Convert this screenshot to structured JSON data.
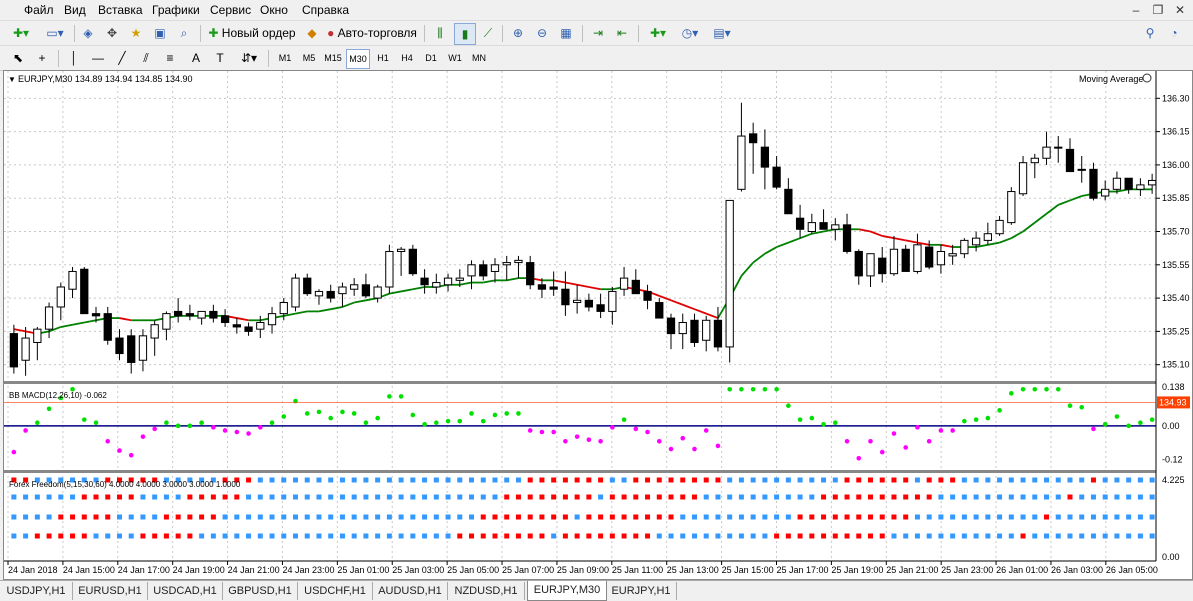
{
  "menu": [
    "Файл",
    "Вид",
    "Вставка",
    "Графики",
    "Сервис",
    "Окно",
    "Справка"
  ],
  "toolbar": {
    "new_order": "Новый ордер",
    "autotrading": "Авто-торговля"
  },
  "timeframes": [
    "M1",
    "M5",
    "M15",
    "M30",
    "H1",
    "H4",
    "D1",
    "W1",
    "MN"
  ],
  "active_timeframe": "M30",
  "chart": {
    "header": "EURJPY,M30  134.89 134.94 134.85 134.90",
    "indicator_label": "Moving Average",
    "current_price": "134.93",
    "price_ticks": [
      "136.30",
      "136.15",
      "136.00",
      "135.85",
      "135.70",
      "135.55",
      "135.40",
      "135.25",
      "135.10"
    ],
    "macd_label": "BB MACD(12,26,10) -0.062",
    "macd_ticks": [
      "0.138",
      "0.00",
      "-0.12"
    ],
    "ff_label": "Forex Freedom(5,15,30,60) 4.0000 4.0000 3.0000 3.0000 1.0000",
    "ff_ticks": [
      "4.225",
      "0.00"
    ],
    "time_labels": [
      "24 Jan 2018",
      "24 Jan 15:00",
      "24 Jan 17:00",
      "24 Jan 19:00",
      "24 Jan 21:00",
      "24 Jan 23:00",
      "25 Jan 01:00",
      "25 Jan 03:00",
      "25 Jan 05:00",
      "25 Jan 07:00",
      "25 Jan 09:00",
      "25 Jan 11:00",
      "25 Jan 13:00",
      "25 Jan 15:00",
      "25 Jan 17:00",
      "25 Jan 19:00",
      "25 Jan 21:00",
      "25 Jan 23:00",
      "26 Jan 01:00",
      "26 Jan 03:00",
      "26 Jan 05:00"
    ],
    "colors": {
      "bull": "#ffffff",
      "bear": "#000000",
      "ma_up": "#008000",
      "ma_down": "#e00000",
      "macd_up": "#00e000",
      "macd_down": "#ff00ff",
      "zero_line": "#000080",
      "ff_blue": "#3399ff",
      "ff_red": "#ff0000",
      "price_label": "#ff4000"
    }
  },
  "tabs": [
    "USDJPY,H1",
    "EURUSD,H1",
    "USDCAD,H1",
    "GBPUSD,H1",
    "USDCHF,H1",
    "AUDUSD,H1",
    "NZDUSD,H1",
    "EURJPY,M30",
    "EURJPY,H1"
  ],
  "active_tab": "EURJPY,M30",
  "chart_data": {
    "type": "candlestick",
    "symbol": "EURJPY",
    "timeframe": "M30",
    "ylim": [
      135.04,
      136.36
    ],
    "candles": [
      [
        135.24,
        135.28,
        135.06,
        135.09
      ],
      [
        135.12,
        135.27,
        135.05,
        135.22
      ],
      [
        135.2,
        135.27,
        135.12,
        135.26
      ],
      [
        135.26,
        135.38,
        135.22,
        135.36
      ],
      [
        135.36,
        135.47,
        135.3,
        135.45
      ],
      [
        135.44,
        135.54,
        135.4,
        135.52
      ],
      [
        135.53,
        135.54,
        135.35,
        135.33
      ],
      [
        135.33,
        135.36,
        135.29,
        135.32
      ],
      [
        135.33,
        135.36,
        135.19,
        135.21
      ],
      [
        135.22,
        135.26,
        135.12,
        135.15
      ],
      [
        135.23,
        135.26,
        135.06,
        135.11
      ],
      [
        135.12,
        135.26,
        135.07,
        135.23
      ],
      [
        135.22,
        135.3,
        135.14,
        135.28
      ],
      [
        135.26,
        135.34,
        135.21,
        135.33
      ],
      [
        135.34,
        135.4,
        135.29,
        135.32
      ],
      [
        135.33,
        135.37,
        135.3,
        135.32
      ],
      [
        135.31,
        135.34,
        135.28,
        135.34
      ],
      [
        135.34,
        135.37,
        135.29,
        135.31
      ],
      [
        135.32,
        135.35,
        135.27,
        135.29
      ],
      [
        135.28,
        135.31,
        135.24,
        135.27
      ],
      [
        135.27,
        135.29,
        135.23,
        135.25
      ],
      [
        135.26,
        135.32,
        135.22,
        135.29
      ],
      [
        135.28,
        135.36,
        135.24,
        135.33
      ],
      [
        135.33,
        135.4,
        135.3,
        135.38
      ],
      [
        135.36,
        135.51,
        135.34,
        135.49
      ],
      [
        135.49,
        135.51,
        135.41,
        135.42
      ],
      [
        135.41,
        135.44,
        135.37,
        135.43
      ],
      [
        135.43,
        135.46,
        135.38,
        135.4
      ],
      [
        135.42,
        135.47,
        135.36,
        135.45
      ],
      [
        135.44,
        135.49,
        135.41,
        135.46
      ],
      [
        135.46,
        135.51,
        135.4,
        135.41
      ],
      [
        135.4,
        135.46,
        135.38,
        135.45
      ],
      [
        135.45,
        135.64,
        135.42,
        135.61
      ],
      [
        135.61,
        135.63,
        135.5,
        135.62
      ],
      [
        135.62,
        135.64,
        135.5,
        135.51
      ],
      [
        135.49,
        135.53,
        135.42,
        135.46
      ],
      [
        135.45,
        135.51,
        135.42,
        135.47
      ],
      [
        135.46,
        135.51,
        135.43,
        135.49
      ],
      [
        135.48,
        135.53,
        135.45,
        135.49
      ],
      [
        135.5,
        135.57,
        135.44,
        135.55
      ],
      [
        135.55,
        135.57,
        135.48,
        135.5
      ],
      [
        135.52,
        135.58,
        135.47,
        135.55
      ],
      [
        135.55,
        135.59,
        135.48,
        135.56
      ],
      [
        135.56,
        135.59,
        135.49,
        135.57
      ],
      [
        135.56,
        135.59,
        135.44,
        135.46
      ],
      [
        135.46,
        135.49,
        135.4,
        135.44
      ],
      [
        135.45,
        135.52,
        135.41,
        135.44
      ],
      [
        135.44,
        135.52,
        135.32,
        135.37
      ],
      [
        135.38,
        135.46,
        135.33,
        135.39
      ],
      [
        135.39,
        135.42,
        135.34,
        135.36
      ],
      [
        135.37,
        135.42,
        135.31,
        135.34
      ],
      [
        135.34,
        135.45,
        135.28,
        135.43
      ],
      [
        135.44,
        135.54,
        135.41,
        135.49
      ],
      [
        135.48,
        135.53,
        135.42,
        135.42
      ],
      [
        135.43,
        135.46,
        135.35,
        135.39
      ],
      [
        135.38,
        135.4,
        135.31,
        135.31
      ],
      [
        135.31,
        135.33,
        135.17,
        135.24
      ],
      [
        135.24,
        135.33,
        135.17,
        135.29
      ],
      [
        135.3,
        135.33,
        135.18,
        135.2
      ],
      [
        135.21,
        135.32,
        135.16,
        135.3
      ],
      [
        135.3,
        135.36,
        135.16,
        135.18
      ],
      [
        135.18,
        135.82,
        135.11,
        135.84
      ],
      [
        135.89,
        136.28,
        135.88,
        136.13
      ],
      [
        136.14,
        136.19,
        135.96,
        136.1
      ],
      [
        136.08,
        136.16,
        135.89,
        135.99
      ],
      [
        135.99,
        136.04,
        135.89,
        135.9
      ],
      [
        135.89,
        135.94,
        135.78,
        135.78
      ],
      [
        135.76,
        135.82,
        135.67,
        135.71
      ],
      [
        135.7,
        135.78,
        135.69,
        135.74
      ],
      [
        135.74,
        135.8,
        135.71,
        135.71
      ],
      [
        135.71,
        135.76,
        135.66,
        135.73
      ],
      [
        135.73,
        135.78,
        135.6,
        135.61
      ],
      [
        135.61,
        135.62,
        135.46,
        135.5
      ],
      [
        135.5,
        135.6,
        135.45,
        135.6
      ],
      [
        135.58,
        135.63,
        135.47,
        135.51
      ],
      [
        135.51,
        135.68,
        135.5,
        135.62
      ],
      [
        135.62,
        135.64,
        135.52,
        135.52
      ],
      [
        135.52,
        135.69,
        135.51,
        135.64
      ],
      [
        135.63,
        135.66,
        135.53,
        135.54
      ],
      [
        135.55,
        135.64,
        135.51,
        135.61
      ],
      [
        135.59,
        135.64,
        135.55,
        135.6
      ],
      [
        135.6,
        135.67,
        135.58,
        135.66
      ],
      [
        135.64,
        135.7,
        135.61,
        135.67
      ],
      [
        135.66,
        135.74,
        135.64,
        135.69
      ],
      [
        135.69,
        135.77,
        135.68,
        135.75
      ],
      [
        135.74,
        135.9,
        135.73,
        135.88
      ],
      [
        135.87,
        136.04,
        135.86,
        136.01
      ],
      [
        136.01,
        136.05,
        135.94,
        136.03
      ],
      [
        136.03,
        136.15,
        136.0,
        136.08
      ],
      [
        136.08,
        136.13,
        136.01,
        136.08
      ],
      [
        136.07,
        136.12,
        135.97,
        135.97
      ],
      [
        135.98,
        136.04,
        135.92,
        135.98
      ],
      [
        135.98,
        136.01,
        135.84,
        135.85
      ],
      [
        135.86,
        135.93,
        135.84,
        135.89
      ],
      [
        135.89,
        135.97,
        135.87,
        135.94
      ],
      [
        135.94,
        135.94,
        135.87,
        135.89
      ],
      [
        135.89,
        135.94,
        135.86,
        135.91
      ],
      [
        135.91,
        135.96,
        135.87,
        135.93
      ]
    ],
    "ma": [
      135.26,
      135.25,
      135.24,
      135.25,
      135.27,
      135.28,
      135.29,
      135.3,
      135.31,
      135.31,
      135.3,
      135.3,
      135.3,
      135.31,
      135.32,
      135.32,
      135.32,
      135.32,
      135.32,
      135.31,
      135.3,
      135.3,
      135.31,
      135.32,
      135.33,
      135.34,
      135.34,
      135.35,
      135.36,
      135.38,
      135.39,
      135.4,
      135.42,
      135.43,
      135.44,
      135.45,
      135.45,
      135.46,
      135.46,
      135.47,
      135.47,
      135.48,
      135.48,
      135.49,
      135.49,
      135.48,
      135.48,
      135.47,
      135.46,
      135.45,
      135.44,
      135.44,
      135.45,
      135.44,
      135.43,
      135.41,
      135.39,
      135.37,
      135.35,
      135.33,
      135.31,
      135.4,
      135.5,
      135.56,
      135.6,
      135.63,
      135.65,
      135.67,
      135.69,
      135.7,
      135.71,
      135.71,
      135.71,
      135.7,
      135.68,
      135.67,
      135.66,
      135.65,
      135.64,
      135.64,
      135.63,
      135.63,
      135.63,
      135.64,
      135.65,
      135.67,
      135.7,
      135.74,
      135.78,
      135.82,
      135.84,
      135.86,
      135.87,
      135.88,
      135.88,
      135.89,
      135.89,
      135.89
    ]
  }
}
